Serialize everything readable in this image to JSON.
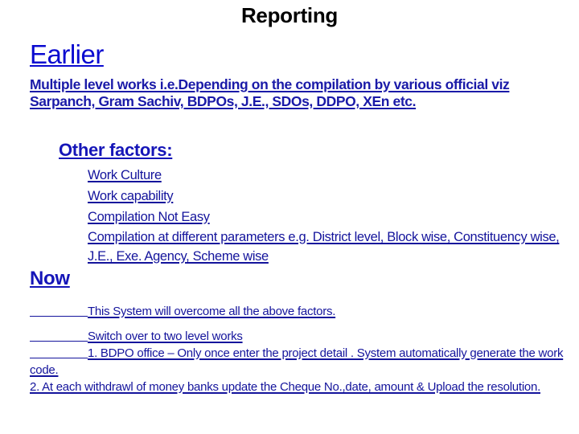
{
  "slide": {
    "title": "Reporting"
  },
  "earlier": {
    "heading": "Earlier",
    "intro": "Multiple level works i.e.Depending on the compilation by various official viz Sarpanch, Gram Sachiv, BDPOs, J.E., SDOs, DDPO, XEn etc.",
    "other_factors_heading": "Other factors:",
    "factors": [
      "Work Culture",
      "Work capability",
      "Compilation Not Easy",
      "Compilation at different parameters e.g. District level, Block wise, Constituency wise, J.E., Exe. Agency, Scheme wise"
    ]
  },
  "now": {
    "heading": "Now",
    "lines": [
      "This System will overcome all the above factors.",
      "Switch over to two level works",
      "1. BDPO office – Only once enter the project detail . System automatically generate the work code.",
      "2. At each withdrawl of money banks update the Cheque No.,date, amount & Upload the resolution."
    ]
  },
  "colors": {
    "title": "#000000",
    "heading_blue": "#0a0ad0",
    "body_navy": "#14149c"
  }
}
